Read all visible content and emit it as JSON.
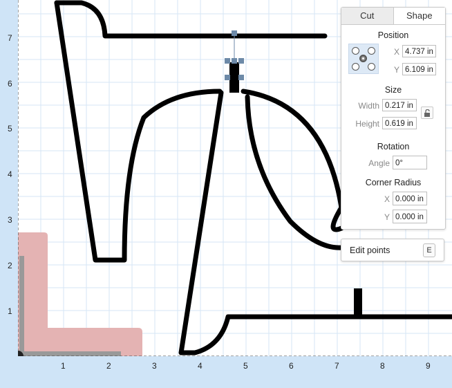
{
  "ruler": {
    "y_labels": [
      "7",
      "6",
      "5",
      "4",
      "3",
      "2",
      "1"
    ],
    "x_labels": [
      "1",
      "2",
      "3",
      "4",
      "5",
      "6",
      "7",
      "8",
      "9"
    ]
  },
  "panel": {
    "tabs": [
      {
        "label": "Cut",
        "active": false
      },
      {
        "label": "Shape",
        "active": true
      }
    ],
    "position": {
      "title": "Position",
      "x_label": "X",
      "x_value": "4.737 in",
      "y_label": "Y",
      "y_value": "6.109 in",
      "anchor_selected": "center"
    },
    "size": {
      "title": "Size",
      "width_label": "Width",
      "width_value": "0.217 in",
      "height_label": "Height",
      "height_value": "0.619 in",
      "lock_icon": "unlock-icon"
    },
    "rotation": {
      "title": "Rotation",
      "angle_label": "Angle",
      "angle_value": "0°"
    },
    "corner_radius": {
      "title": "Corner Radius",
      "x_label": "X",
      "x_value": "0.000 in",
      "y_label": "Y",
      "y_value": "0.000 in"
    }
  },
  "edit_points": {
    "label": "Edit points",
    "shortcut": "E"
  },
  "colors": {
    "grid_line": "#d6e6f5",
    "ruler_bg": "#cfe4f7",
    "stroke": "#000000",
    "material_region": "#e4b3b3",
    "handle": "#6d8aa8"
  }
}
